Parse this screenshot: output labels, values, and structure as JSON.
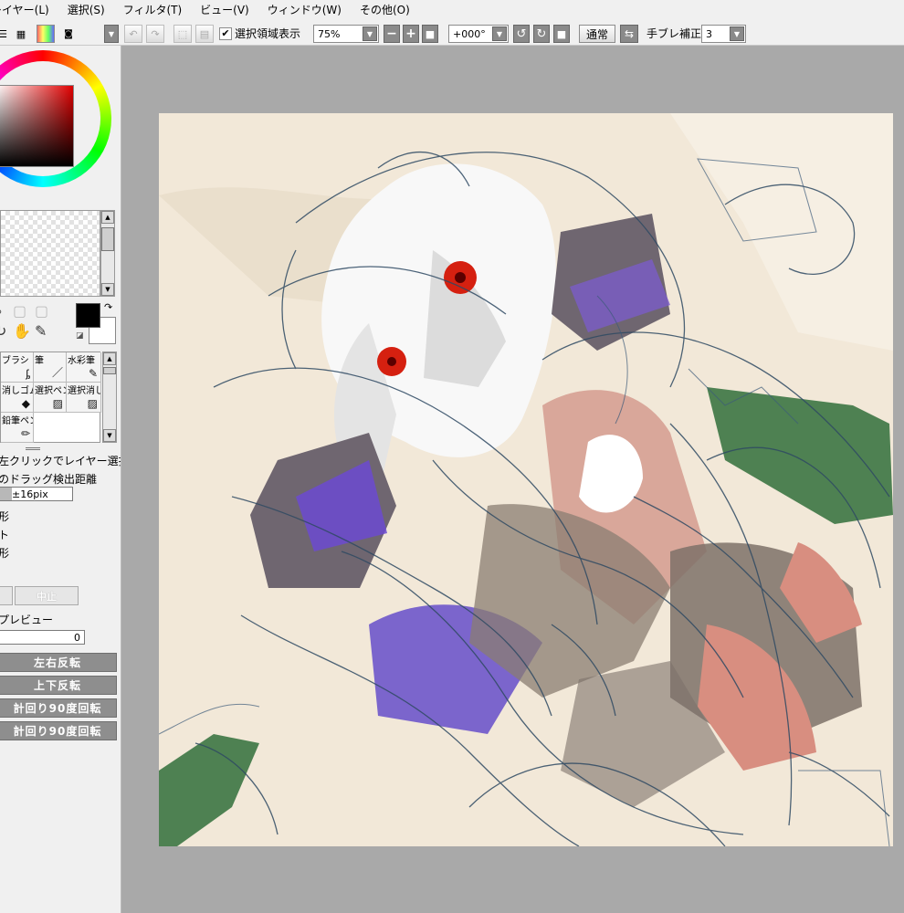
{
  "menu": [
    "レイヤー(L)",
    "選択(S)",
    "フィルタ(T)",
    "ビュー(V)",
    "ウィンドウ(W)",
    "その他(O)"
  ],
  "toolbar": {
    "show_selection_label": "選択領域表示",
    "show_selection_checked": true,
    "zoom": "75%",
    "rotation": "+000°",
    "mode_label": "通常",
    "stabilizer_label": "手ブレ補正",
    "stabilizer_value": "3"
  },
  "brushes": [
    {
      "label": "ブラシ",
      "icon": "brush-icon"
    },
    {
      "label": "筆",
      "icon": "pen-icon"
    },
    {
      "label": "水彩筆",
      "icon": "watercolor-icon"
    },
    {
      "label": "消しゴム",
      "icon": "eraser-icon"
    },
    {
      "label": "選択ペン",
      "icon": "select-pen-icon"
    },
    {
      "label": "選択消し",
      "icon": "select-erase-icon"
    },
    {
      "label": "鉛筆ペン",
      "icon": "pencil-icon"
    }
  ],
  "tool_options": {
    "line1": "左クリックでレイヤー選択",
    "line2": "のドラッグ検出距離",
    "drag_distance": "±16pix",
    "opt1": "形",
    "opt2": "ト",
    "opt3": "形",
    "cancel_label": "中止",
    "preview_label": "プレビュー",
    "preview_value": "0"
  },
  "transform_buttons": [
    "左右反転",
    "上下反転",
    "計回り90度回転",
    "計回り90度回転"
  ],
  "colors": {
    "foreground": "#000000",
    "background": "#ffffff",
    "selected_hue": "#e00000"
  }
}
